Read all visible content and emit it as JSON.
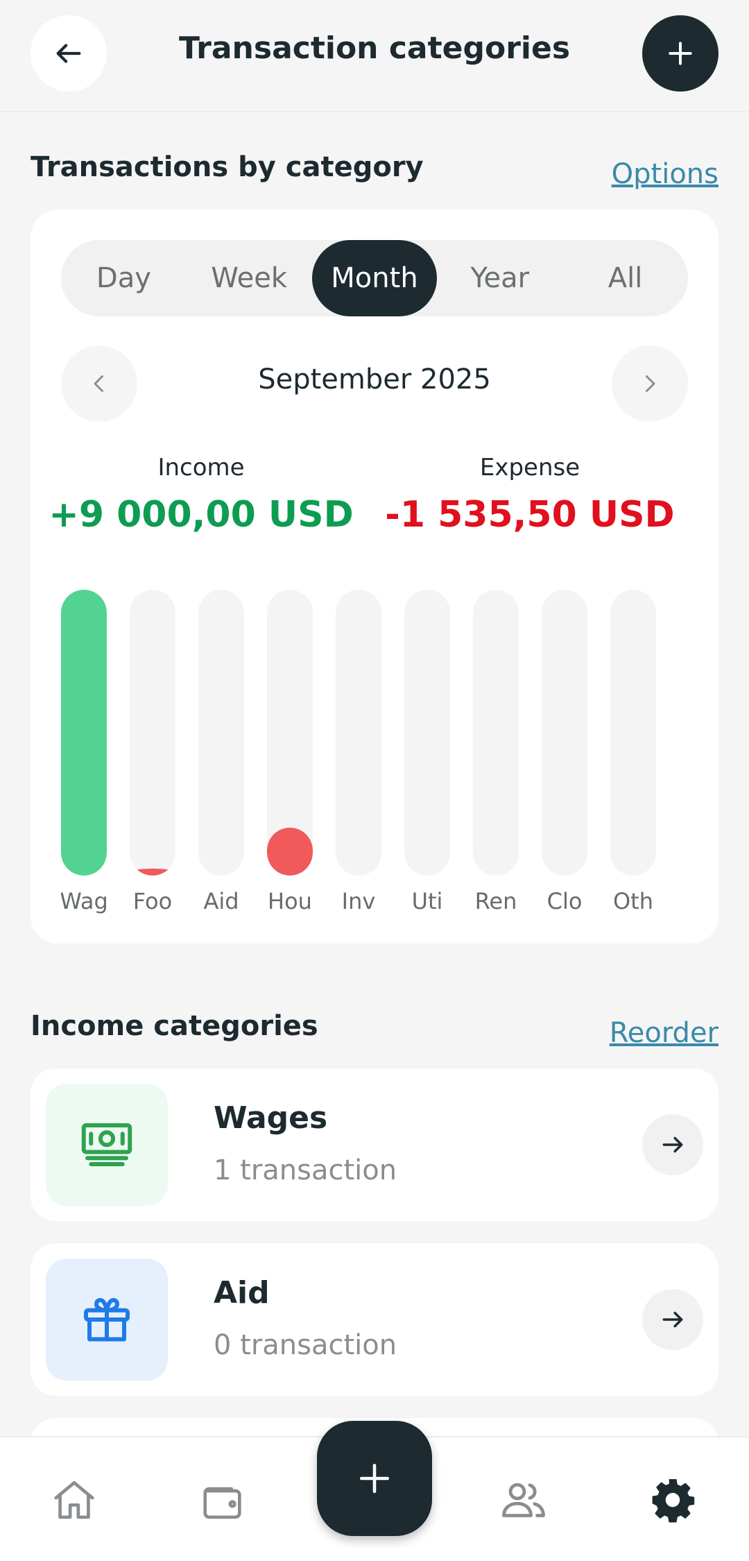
{
  "header": {
    "title": "Transaction categories"
  },
  "summary_section": {
    "title": "Transactions by category",
    "options_label": "Options"
  },
  "period_tabs": [
    {
      "label": "Day",
      "active": false
    },
    {
      "label": "Week",
      "active": false
    },
    {
      "label": "Month",
      "active": true
    },
    {
      "label": "Year",
      "active": false
    },
    {
      "label": "All",
      "active": false
    }
  ],
  "period": {
    "label": "September 2025"
  },
  "totals": {
    "income_label": "Income",
    "income_value": "+9 000,00 USD",
    "income_color": "#0e9c52",
    "expense_label": "Expense",
    "expense_value": "-1 535,50 USD",
    "expense_color": "#e0101e"
  },
  "chart_data": {
    "type": "bar",
    "categories": [
      "Wag",
      "Foo",
      "Aid",
      "Hou",
      "Inv",
      "Uti",
      "Ren",
      "Clo",
      "Oth"
    ],
    "values": [
      9000,
      30,
      0,
      1500,
      0,
      0,
      0,
      0,
      0
    ],
    "kinds": [
      "income",
      "expense",
      "income",
      "expense",
      "income",
      "expense",
      "expense",
      "expense",
      "expense"
    ],
    "colors": {
      "income": "#52d391",
      "expense": "#f05a5a",
      "track": "#f4f4f4"
    }
  },
  "income_section": {
    "title": "Income categories",
    "reorder_label": "Reorder"
  },
  "income_categories": [
    {
      "name": "Wages",
      "count": "1 transaction",
      "icon": "cash-icon",
      "icon_bg": "#ecfaf1",
      "icon_color": "#2fa24f"
    },
    {
      "name": "Aid",
      "count": "0 transaction",
      "icon": "gift-icon",
      "icon_bg": "#e6f0fd",
      "icon_color": "#1f7be6"
    }
  ],
  "bottom_nav": [
    {
      "icon": "home-icon"
    },
    {
      "icon": "wallet-icon"
    },
    {
      "icon": "plus-icon"
    },
    {
      "icon": "people-icon"
    },
    {
      "icon": "gear-icon"
    }
  ]
}
